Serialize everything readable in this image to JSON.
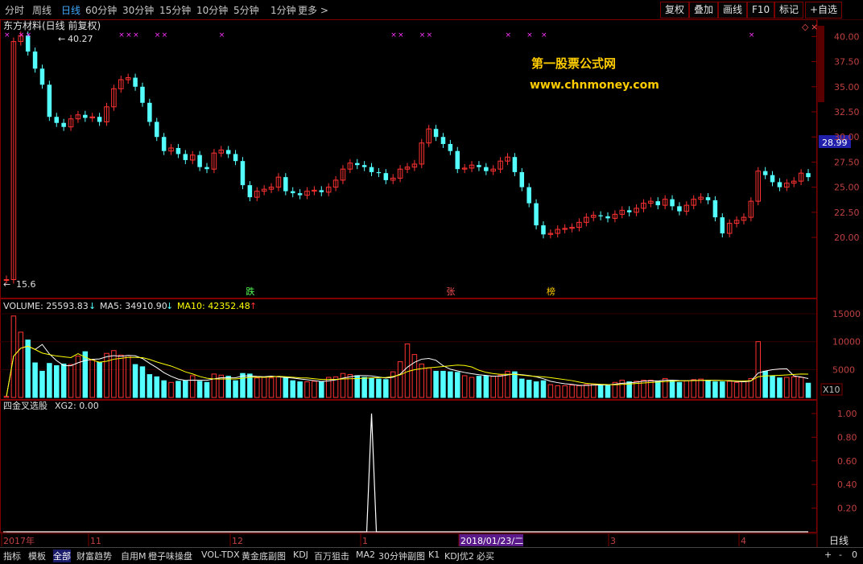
{
  "toolbar": {
    "timeframes": [
      {
        "label": "分时",
        "active": false
      },
      {
        "label": "周线",
        "active": false
      },
      {
        "label": "日线",
        "active": true
      },
      {
        "label": "60分钟",
        "active": false
      },
      {
        "label": "30分钟",
        "active": false
      },
      {
        "label": "15分钟",
        "active": false
      },
      {
        "label": "10分钟",
        "active": false
      },
      {
        "label": "5分钟",
        "active": false
      },
      {
        "label": "1分钟",
        "active": false
      },
      {
        "label": "更多 >",
        "active": false
      }
    ],
    "right_buttons": [
      "复权",
      "叠加",
      "画线",
      "F10",
      "标记",
      "+自选"
    ]
  },
  "price_panel": {
    "title": "东方材料(日线 前复权)",
    "high_label": "40.27",
    "low_label": "15.6",
    "current_price": "28.99",
    "y_ticks": [
      "40.00",
      "37.50",
      "35.00",
      "32.50",
      "30.00",
      "27.50",
      "25.00",
      "22.50",
      "20.00"
    ],
    "event_markers": [
      "跌",
      "张",
      "榜"
    ],
    "watermark_name": "第一股票公式网",
    "watermark_url": "www.chnmoney.com"
  },
  "volume_panel": {
    "label_volume": "VOLUME: 25593.83",
    "label_ma5": "MA5: 34910.90",
    "label_ma10": "MA10: 42352.48",
    "y_ticks": [
      "15000",
      "10000",
      "5000"
    ],
    "unit": "X10"
  },
  "indicator_panel": {
    "label": "四金叉选股",
    "xg2": "XG2: 0.00",
    "y_ticks": [
      "1.00",
      "0.80",
      "0.60",
      "0.40",
      "0.20"
    ]
  },
  "x_axis": {
    "labels": [
      "2017年",
      "11",
      "12",
      "1",
      "2018/01/23/二",
      "3",
      "4"
    ],
    "period": "日线",
    "nav": [
      "+",
      "-",
      "0"
    ]
  },
  "bottom_tabs": [
    "指标",
    "模板",
    "全部",
    "财富趋势",
    "自用M",
    "橙子味操盘",
    "VOL-TDX",
    "黄金底副图",
    "KDJ",
    "百万狙击",
    "MA2",
    "30分钟副图",
    "K1",
    "KDJ优2",
    "必买"
  ],
  "colors": {
    "up": "#ff3232",
    "down": "#54ffff",
    "ma5": "#ffffff",
    "ma10": "#ffff00",
    "grid": "#800000",
    "accent": "#3fa9ff"
  },
  "chart_data": {
    "type": "candlestick",
    "close": [
      15.8,
      39.5,
      40.1,
      38.5,
      36.8,
      35.2,
      32.0,
      31.4,
      31.0,
      31.8,
      32.2,
      31.9,
      32.0,
      31.5,
      33.0,
      34.8,
      35.7,
      35.9,
      35.0,
      33.4,
      31.5,
      30.0,
      28.6,
      28.9,
      28.3,
      27.7,
      28.2,
      27.0,
      26.8,
      28.4,
      28.7,
      28.3,
      27.6,
      25.2,
      24.0,
      24.6,
      24.8,
      25.0,
      26.0,
      24.6,
      24.4,
      24.2,
      24.6,
      24.7,
      24.5,
      25.0,
      25.7,
      26.8,
      27.4,
      27.2,
      27.0,
      26.5,
      26.4,
      25.7,
      25.9,
      26.8,
      27.0,
      27.3,
      29.4,
      30.8,
      30.0,
      29.3,
      28.6,
      26.8,
      26.9,
      27.2,
      27.0,
      26.6,
      26.8,
      27.6,
      28.0,
      26.5,
      25.0,
      23.4,
      21.2,
      20.3,
      20.4,
      20.8,
      20.9,
      21.0,
      21.5,
      22.0,
      22.2,
      22.1,
      21.9,
      22.3,
      22.7,
      22.5,
      22.9,
      23.4,
      23.6,
      23.2,
      23.8,
      23.1,
      22.6,
      23.2,
      23.8,
      24.0,
      23.7,
      22.0,
      20.4,
      21.4,
      21.7,
      22.0,
      23.6,
      26.6,
      26.2,
      25.5,
      25.0,
      25.4,
      25.6,
      26.4,
      26.0
    ],
    "volume": [
      200,
      14600,
      11700,
      10300,
      6200,
      4700,
      6100,
      5700,
      6000,
      5900,
      7400,
      8200,
      6700,
      6300,
      7900,
      8400,
      7600,
      7500,
      5900,
      5500,
      4100,
      3700,
      3000,
      2700,
      2900,
      3000,
      3900,
      2900,
      2700,
      4200,
      4000,
      3800,
      3000,
      4300,
      4200,
      3500,
      3600,
      3500,
      3700,
      3600,
      3000,
      2800,
      2800,
      2900,
      2800,
      3600,
      3700,
      4300,
      4100,
      3900,
      3600,
      3400,
      3300,
      3200,
      4600,
      6400,
      9600,
      7700,
      6000,
      5300,
      4700,
      4700,
      4600,
      4500,
      3900,
      3600,
      3800,
      3900,
      3800,
      4000,
      4700,
      4600,
      3300,
      3100,
      2800,
      3000,
      2300,
      2100,
      2100,
      2200,
      2100,
      2300,
      2400,
      2300,
      2200,
      2700,
      3100,
      2800,
      2900,
      3100,
      3100,
      2900,
      3400,
      3000,
      2700,
      3000,
      3200,
      3300,
      3100,
      2800,
      2800,
      2900,
      2700,
      2900,
      3400,
      10000,
      4700,
      3900,
      3500,
      3600,
      3700,
      3600,
      2559
    ],
    "xg2": [
      {
        "index": 51,
        "value": 1.0
      }
    ],
    "y_range_price": [
      15.6,
      40.27
    ],
    "y_range_volume": [
      0,
      15000
    ],
    "y_range_indicator": [
      0,
      1
    ]
  }
}
